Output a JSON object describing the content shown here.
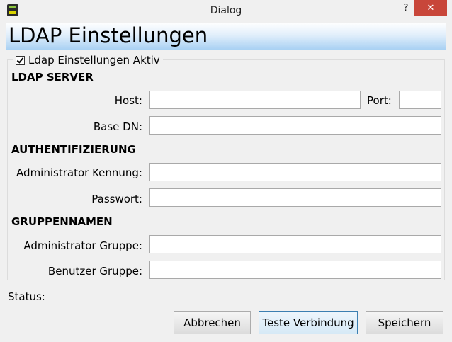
{
  "window": {
    "title": "Dialog",
    "help": "?",
    "close": "✕"
  },
  "header": {
    "title": "LDAP Einstellungen"
  },
  "group": {
    "checkbox_label": "Ldap Einstellungen Aktiv",
    "checked": true
  },
  "ldap_server": {
    "heading": "LDAP SERVER",
    "host_label": "Host:",
    "host_value": "",
    "port_label": "Port:",
    "port_value": "",
    "basedn_label": "Base DN:",
    "basedn_value": ""
  },
  "auth": {
    "heading": "AUTHENTIFIZIERUNG",
    "admin_label": "Administrator Kennung:",
    "admin_value": "",
    "password_label": "Passwort:",
    "password_value": ""
  },
  "groups": {
    "heading": "GRUPPENNAMEN",
    "admin_group_label": "Administrator Gruppe:",
    "admin_group_value": "",
    "user_group_label": "Benutzer Gruppe:",
    "user_group_value": ""
  },
  "status": {
    "label": "Status:"
  },
  "buttons": {
    "cancel": "Abbrechen",
    "test": "Teste Verbindung",
    "save": "Speichern"
  },
  "colors": {
    "close_button": "#c8463a",
    "header_gradient_end": "#a9d1f3",
    "focus_border": "#3c7fb1"
  }
}
